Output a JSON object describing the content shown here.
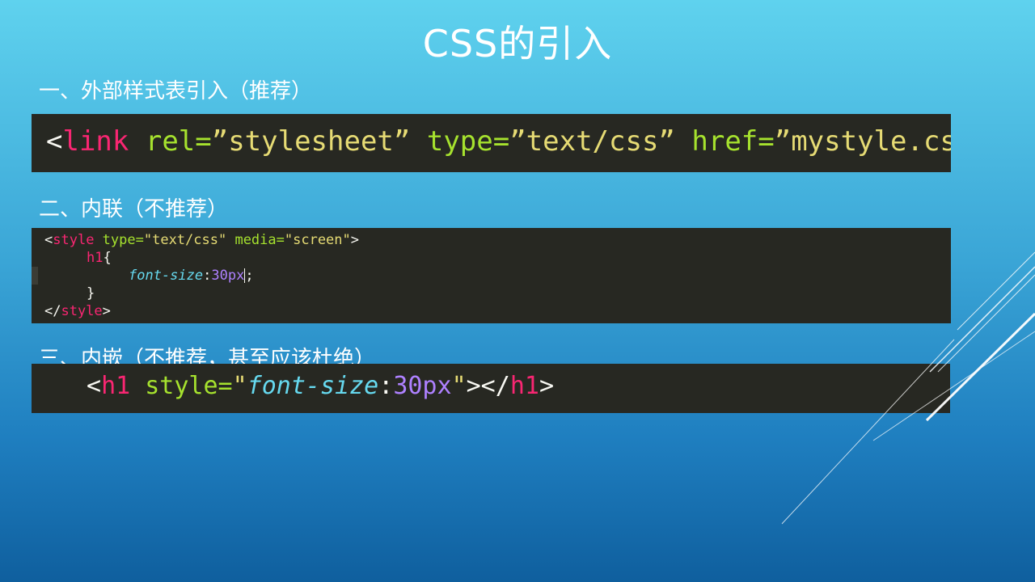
{
  "slide": {
    "title": "CSS的引入",
    "sections": [
      {
        "heading": "一、外部样式表引入（推荐）",
        "code": {
          "lt": "<",
          "tag": "link",
          "rel_attr": " rel=",
          "rel_val": "”stylesheet”",
          "type_attr": " type=",
          "type_val": "”text/css”",
          "href_attr": " href=",
          "href_val": "”mystyle.css”",
          "gt": ">"
        }
      },
      {
        "heading": "二、内联（不推荐）",
        "code": {
          "l1_open": "<",
          "l1_tag": "style",
          "l1_attr1": " type=",
          "l1_val1": "\"text/css\"",
          "l1_attr2": " media=",
          "l1_val2": "\"screen\"",
          "l1_close": ">",
          "l2_sel": "h1",
          "l2_brace": "{",
          "l3_prop": "font-size",
          "l3_colon": ":",
          "l3_num": "30px",
          "l3_semi": ";",
          "l4_brace": "}",
          "l5_open": "</",
          "l5_tag": "style",
          "l5_close": ">"
        }
      },
      {
        "heading": "三、内嵌（不推荐，甚至应该杜绝）",
        "code": {
          "open": "<",
          "tag": "h1",
          "attr": " style=",
          "q1": "\"",
          "prop": "font-size",
          "colon": ":",
          "num": "30px",
          "q2": "\"",
          "mid": "></",
          "tag2": "h1",
          "close": ">"
        }
      }
    ]
  },
  "colors": {
    "code_bg": "#272822",
    "tag": "#f92672",
    "attr": "#a6e22e",
    "string": "#e6db74",
    "property": "#66d9ef",
    "number": "#ae81ff"
  }
}
